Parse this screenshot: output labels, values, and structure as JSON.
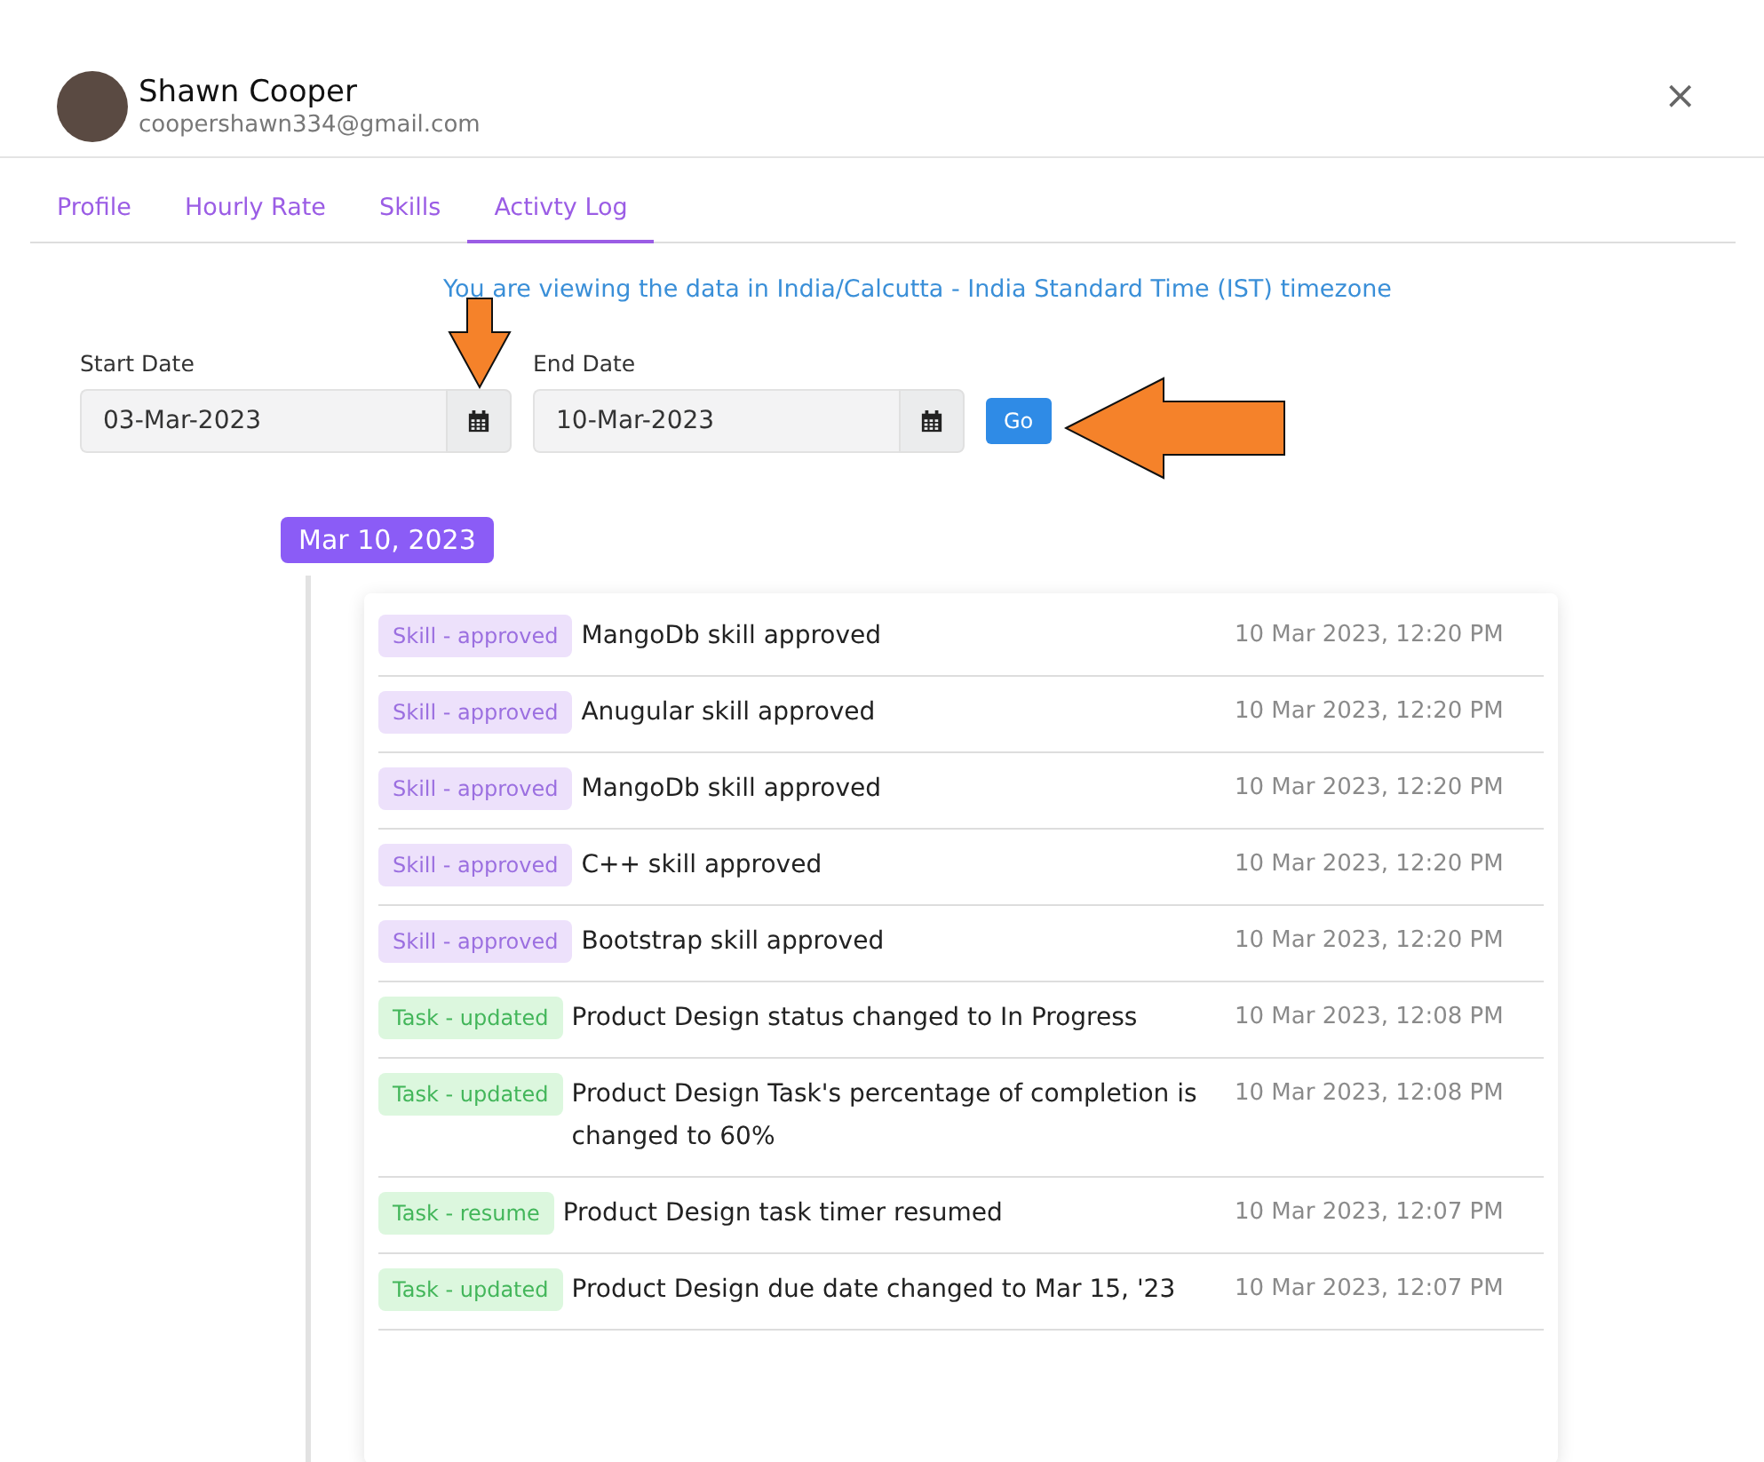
{
  "user": {
    "name": "Shawn Cooper",
    "email": "coopershawn334@gmail.com"
  },
  "close": "×",
  "tabs": [
    {
      "label": "Profile",
      "selected": false
    },
    {
      "label": "Hourly Rate",
      "selected": false
    },
    {
      "label": "Skills",
      "selected": false
    },
    {
      "label": "Activty Log",
      "selected": true
    }
  ],
  "timezone_note": "You are viewing the data in India/Calcutta - India Standard Time (IST) timezone",
  "filters": [
    {
      "label": "Start Date",
      "value": "03-Mar-2023"
    },
    {
      "label": "End Date",
      "value": "10-Mar-2023"
    }
  ],
  "go_button": "Go",
  "annotations": [
    {
      "kind": "down-arrow"
    },
    {
      "kind": "left-arrow"
    }
  ],
  "date_badge": "Mar 10, 2023",
  "entries": [
    {
      "kind": "skill",
      "tag": "Skill - approved",
      "text": "MangoDb skill approved",
      "time": "10 Mar 2023, 12:20 PM"
    },
    {
      "kind": "skill",
      "tag": "Skill - approved",
      "text": "Anugular skill approved",
      "time": "10 Mar 2023, 12:20 PM"
    },
    {
      "kind": "skill",
      "tag": "Skill - approved",
      "text": "MangoDb skill approved",
      "time": "10 Mar 2023, 12:20 PM"
    },
    {
      "kind": "skill",
      "tag": "Skill - approved",
      "text": "C++ skill approved",
      "time": "10 Mar 2023, 12:20 PM"
    },
    {
      "kind": "skill",
      "tag": "Skill - approved",
      "text": "Bootstrap skill approved",
      "time": "10 Mar 2023, 12:20 PM"
    },
    {
      "kind": "task",
      "tag": "Task - updated",
      "text": "Product Design status changed to In Progress",
      "time": "10 Mar 2023, 12:08 PM"
    },
    {
      "kind": "task",
      "tag": "Task - updated",
      "text": "Product Design Task's percentage of completion is changed to 60%",
      "time": "10 Mar 2023, 12:08 PM"
    },
    {
      "kind": "task",
      "tag": "Task - resume",
      "text": "Product Design task timer resumed",
      "time": "10 Mar 2023, 12:07 PM"
    },
    {
      "kind": "task",
      "tag": "Task - updated",
      "text": "Product Design due date changed to Mar 15, '23",
      "time": "10 Mar 2023, 12:07 PM"
    }
  ]
}
